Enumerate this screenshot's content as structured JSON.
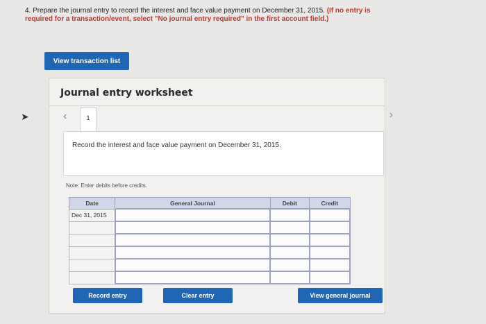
{
  "question": {
    "number": "4.",
    "text": "Prepare the journal entry to record the interest and face value payment on December 31, 2015.",
    "instruction": "(If no entry is required for a transaction/event, select \"No journal entry required\" in the first account field.)"
  },
  "view_transaction_button": "View transaction list",
  "worksheet": {
    "title": "Journal entry worksheet",
    "tab_number": "1",
    "description": "Record the interest and face value payment on December 31, 2015.",
    "note": "Note: Enter debits before credits.",
    "columns": [
      "Date",
      "General Journal",
      "Debit",
      "Credit"
    ],
    "rows": [
      {
        "date": "Dec 31, 2015"
      },
      {
        "date": ""
      },
      {
        "date": ""
      },
      {
        "date": ""
      },
      {
        "date": ""
      },
      {
        "date": ""
      }
    ]
  },
  "buttons": {
    "record": "Record entry",
    "clear": "Clear entry",
    "view_journal": "View general journal"
  },
  "colors": {
    "button_blue": "#1f66b5",
    "instruction_red": "#c0352b",
    "header_blue": "#cfd7e8"
  }
}
